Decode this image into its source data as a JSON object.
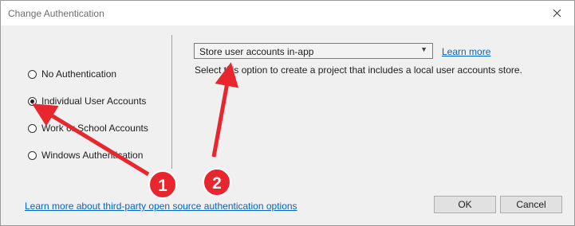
{
  "window": {
    "title": "Change Authentication",
    "close_icon": "close-icon"
  },
  "auth_options": [
    {
      "label": "No Authentication",
      "selected": false
    },
    {
      "label": "Individual User Accounts",
      "selected": true
    },
    {
      "label": "Work or School Accounts",
      "selected": false
    },
    {
      "label": "Windows Authentication",
      "selected": false
    }
  ],
  "account_store": {
    "selected": "Store user accounts in-app",
    "dropdown_icon": "chevron-down-icon",
    "learn_more": "Learn more",
    "description": "Select this option to create a project that includes a local user accounts store."
  },
  "footer": {
    "third_party_link": "Learn more about third-party open source authentication options",
    "ok_label": "OK",
    "cancel_label": "Cancel"
  },
  "annotations": {
    "badge_1": "1",
    "badge_2": "2",
    "color": "#e8262d"
  },
  "colors": {
    "link": "#0066cc",
    "dialog_bg": "#f0f0f0",
    "annotation": "#e8262d"
  }
}
